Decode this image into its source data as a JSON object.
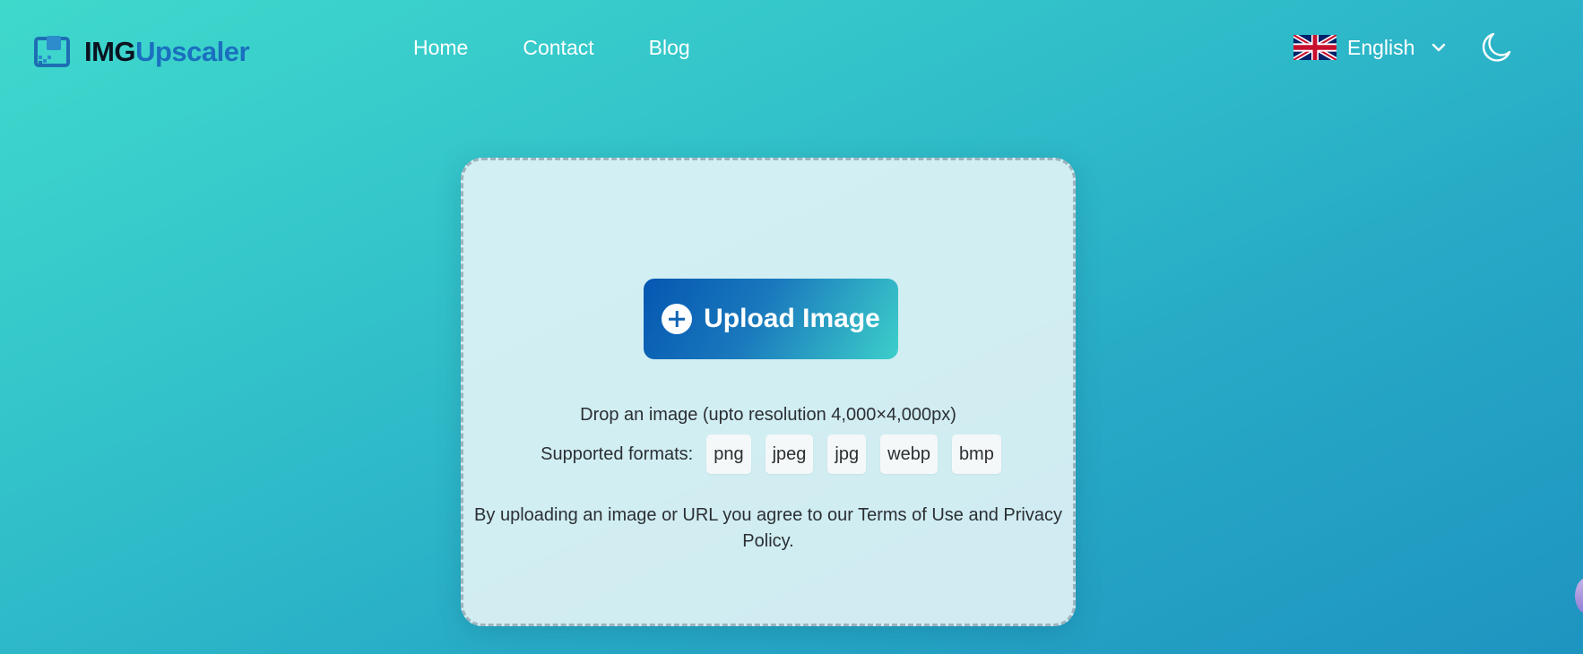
{
  "brand": {
    "name_part1": "IMG",
    "name_part2": "Upscaler"
  },
  "nav": {
    "items": [
      {
        "label": "Home"
      },
      {
        "label": "Contact"
      },
      {
        "label": "Blog"
      }
    ]
  },
  "language": {
    "selected": "English",
    "flag_icon": "uk-flag-icon"
  },
  "theme_toggle_icon": "moon-icon",
  "upload": {
    "button_label": "Upload Image",
    "drop_text": "Drop an image (upto resolution 4,000×4,000px)",
    "formats_label": "Supported formats:",
    "formats": [
      "png",
      "jpeg",
      "jpg",
      "webp",
      "bmp"
    ],
    "terms_text": "By uploading an image or URL you agree to our Terms of Use and Privacy Policy."
  },
  "colors": {
    "background_start": "#3fd9cc",
    "background_end": "#1e94c0",
    "button_start": "#0557b1",
    "button_end": "#3dcfca",
    "brand_accent": "#1a6fbf"
  }
}
